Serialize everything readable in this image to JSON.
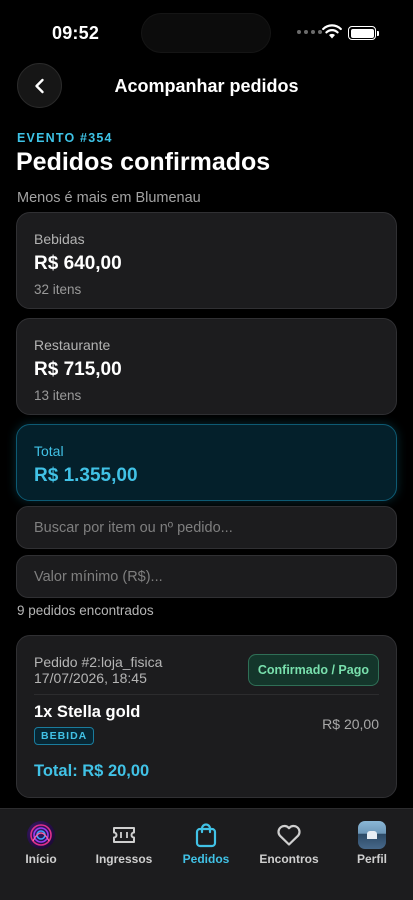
{
  "status_bar": {
    "time": "09:52"
  },
  "header": {
    "title": "Acompanhar pedidos",
    "back_icon": "chevron-left-icon"
  },
  "event": {
    "tag": "EVENTO #354",
    "title": "Pedidos confirmados",
    "subtitle": "Menos é mais em Blumenau"
  },
  "summary": {
    "bebidas": {
      "label": "Bebidas",
      "value": "R$ 640,00",
      "count": "32 itens"
    },
    "restaurante": {
      "label": "Restaurante",
      "value": "R$ 715,00",
      "count": "13 itens"
    },
    "total": {
      "label": "Total",
      "value": "R$ 1.355,00"
    }
  },
  "filters": {
    "search_placeholder": "Buscar por item ou nº pedido...",
    "min_value_placeholder": "Valor mínimo (R$)..."
  },
  "results": {
    "count_text": "9 pedidos encontrados"
  },
  "orders": [
    {
      "id": "Pedido #2:loja_fisica",
      "date": "17/07/2026, 18:45",
      "status": "Confirmado / Pago",
      "item": "1x Stella gold",
      "category": "BEBIDA",
      "price": "R$ 20,00",
      "total": "Total: R$ 20,00"
    }
  ],
  "tabs": [
    {
      "label": "Início",
      "icon": "app-logo-icon"
    },
    {
      "label": "Ingressos",
      "icon": "ticket-icon"
    },
    {
      "label": "Pedidos",
      "icon": "shopping-bag-icon",
      "active": true
    },
    {
      "label": "Encontros",
      "icon": "heart-icon"
    },
    {
      "label": "Perfil",
      "icon": "avatar-icon"
    }
  ],
  "colors": {
    "accent": "#41c2e6",
    "success": "#79e0ad",
    "background": "#000000",
    "card": "#1c1c1e"
  }
}
